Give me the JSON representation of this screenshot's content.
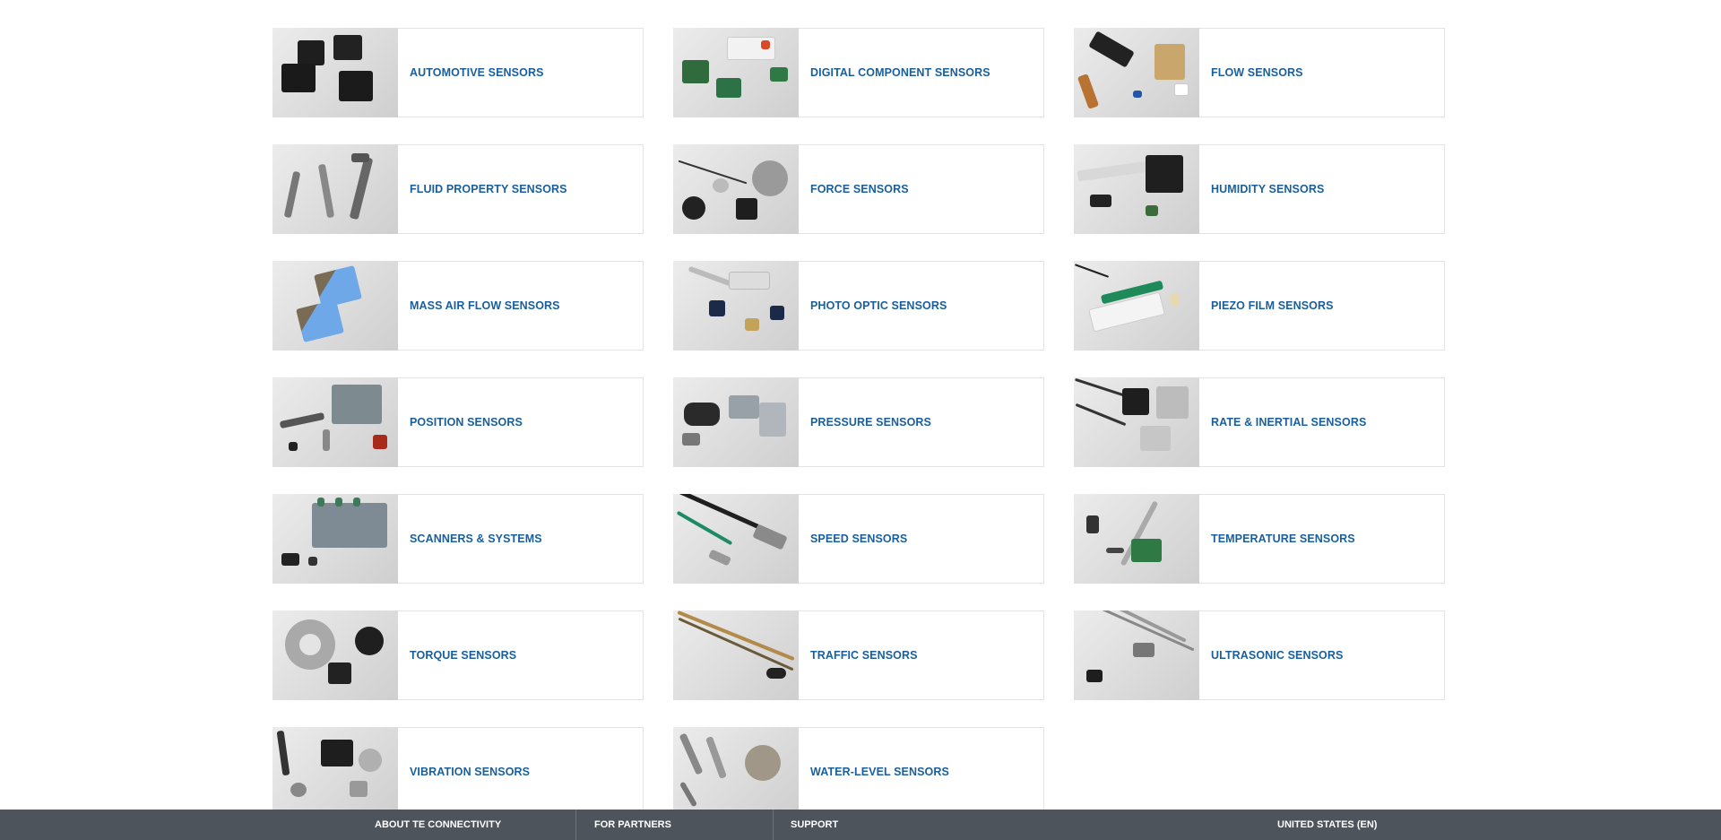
{
  "categories": [
    {
      "label": "AUTOMOTIVE SENSORS",
      "icon": "automotive-sensors-product-image"
    },
    {
      "label": "DIGITAL COMPONENT SENSORS",
      "icon": "digital-component-sensors-product-image"
    },
    {
      "label": "FLOW SENSORS",
      "icon": "flow-sensors-product-image"
    },
    {
      "label": "FLUID PROPERTY SENSORS",
      "icon": "fluid-property-sensors-product-image"
    },
    {
      "label": "FORCE SENSORS",
      "icon": "force-sensors-product-image"
    },
    {
      "label": "HUMIDITY SENSORS",
      "icon": "humidity-sensors-product-image"
    },
    {
      "label": "MASS AIR FLOW SENSORS",
      "icon": "mass-air-flow-sensors-product-image"
    },
    {
      "label": "PHOTO OPTIC SENSORS",
      "icon": "photo-optic-sensors-product-image"
    },
    {
      "label": "PIEZO FILM SENSORS",
      "icon": "piezo-film-sensors-product-image"
    },
    {
      "label": "POSITION SENSORS",
      "icon": "position-sensors-product-image"
    },
    {
      "label": "PRESSURE SENSORS",
      "icon": "pressure-sensors-product-image"
    },
    {
      "label": "RATE & INERTIAL SENSORS",
      "icon": "rate-inertial-sensors-product-image"
    },
    {
      "label": "SCANNERS & SYSTEMS",
      "icon": "scanners-systems-product-image"
    },
    {
      "label": "SPEED SENSORS",
      "icon": "speed-sensors-product-image"
    },
    {
      "label": "TEMPERATURE SENSORS",
      "icon": "temperature-sensors-product-image"
    },
    {
      "label": "TORQUE SENSORS",
      "icon": "torque-sensors-product-image"
    },
    {
      "label": "TRAFFIC SENSORS",
      "icon": "traffic-sensors-product-image"
    },
    {
      "label": "ULTRASONIC SENSORS",
      "icon": "ultrasonic-sensors-product-image"
    },
    {
      "label": "VIBRATION SENSORS",
      "icon": "vibration-sensors-product-image"
    },
    {
      "label": "WATER-LEVEL SENSORS",
      "icon": "water-level-sensors-product-image"
    }
  ],
  "footer": {
    "about": "ABOUT TE CONNECTIVITY",
    "partners": "FOR PARTNERS",
    "support": "SUPPORT",
    "region": "UNITED STATES (EN)"
  },
  "colors": {
    "link": "#1a5f9c",
    "card_border": "#e3e3e3",
    "footer_bg": "#4d545c",
    "footer_text": "#ffffff"
  }
}
